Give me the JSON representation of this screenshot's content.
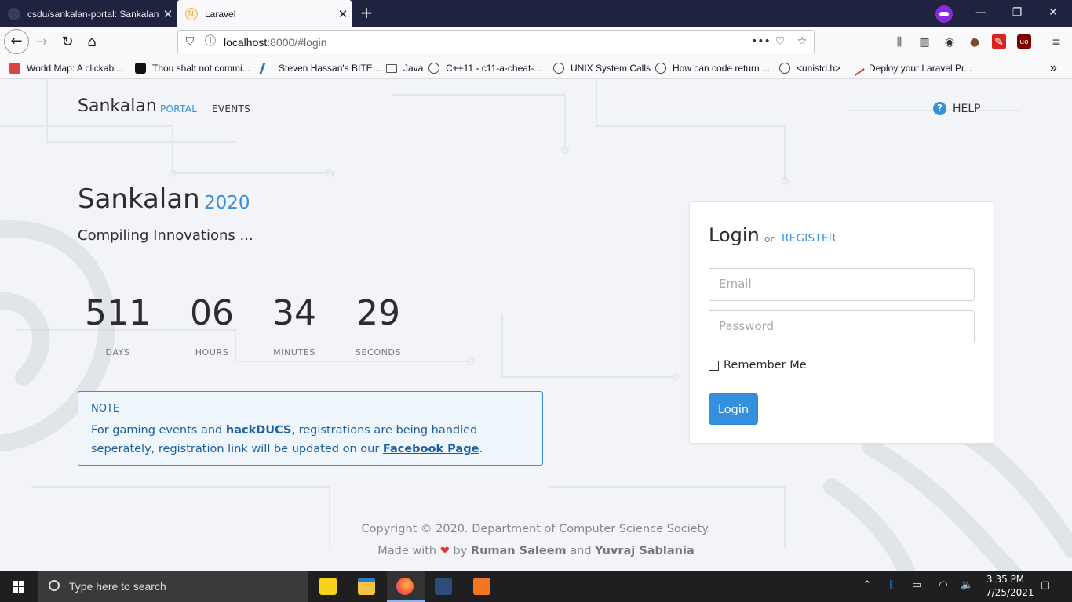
{
  "browser": {
    "tabs": [
      {
        "title": "csdu/sankalan-portal: Sankalan",
        "active": false
      },
      {
        "title": "Laravel",
        "active": true
      }
    ],
    "url": {
      "host": "localhost",
      "rest": ":8000/#login"
    },
    "bookmarks": [
      {
        "label": "World Map: A clickabl...",
        "icon": "g-icon"
      },
      {
        "label": "Thou shalt not commi...",
        "icon": "heart-icon"
      },
      {
        "label": "Steven Hassan's BITE ...",
        "icon": "squiggle-icon"
      },
      {
        "label": "Java",
        "icon": "folder-icon"
      },
      {
        "label": "C++11 - c11-a-cheat-...",
        "icon": "globe-icon"
      },
      {
        "label": "UNIX System Calls",
        "icon": "globe-icon"
      },
      {
        "label": "How can code return ...",
        "icon": "globe-icon"
      },
      {
        "label": "<unistd.h>",
        "icon": "globe-icon"
      },
      {
        "label": "Deploy your Laravel Pr...",
        "icon": "rocket-icon"
      }
    ]
  },
  "site": {
    "brand": "Sankalan",
    "brand_suffix": "PORTAL",
    "nav_events": "EVENTS",
    "help": "HELP",
    "hero_title": "Sankalan",
    "hero_year": "2020",
    "hero_subtitle": "Compiling Innovations ...",
    "countdown": [
      {
        "value": "511",
        "label": "DAYS"
      },
      {
        "value": "06",
        "label": "HOURS"
      },
      {
        "value": "34",
        "label": "MINUTES"
      },
      {
        "value": "29",
        "label": "SECONDS"
      }
    ],
    "note": {
      "title": "NOTE",
      "text_a": "For gaming events and ",
      "text_bold": "hackDUCS",
      "text_b": ", registrations are being handled seperately, registration link will be updated on our ",
      "link": "Facebook Page",
      "text_c": "."
    },
    "login": {
      "title": "Login",
      "or": "or",
      "register": "REGISTER",
      "email_placeholder": "Email",
      "password_placeholder": "Password",
      "remember": "Remember Me",
      "button": "Login"
    },
    "footer": {
      "line1": "Copyright © 2020. Department of Computer Science Society.",
      "made_with": "Made with",
      "heart": "❤",
      "by": "by",
      "author1": "Ruman Saleem",
      "and": "and",
      "author2": "Yuvraj Sablania"
    }
  },
  "taskbar": {
    "search_placeholder": "Type here to search",
    "time": "3:35 PM",
    "date": "7/25/2021"
  },
  "colors": {
    "accent": "#3490dc",
    "heart": "#e3342f",
    "tabbar": "#202340"
  }
}
